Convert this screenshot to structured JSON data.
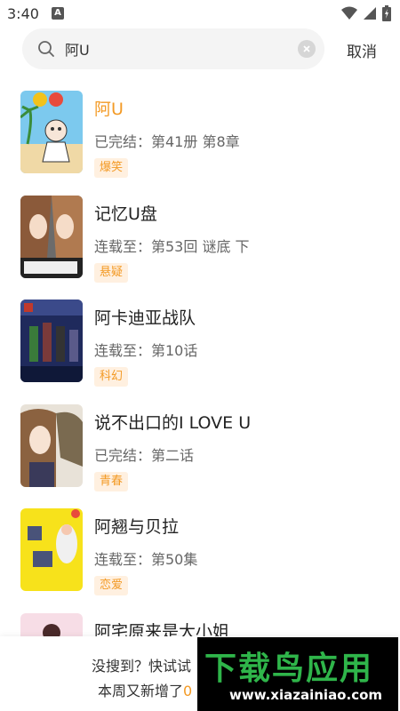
{
  "status_bar": {
    "time": "3:40",
    "notification_badge": "A"
  },
  "search": {
    "query": "阿U",
    "cancel_label": "取消"
  },
  "results": [
    {
      "title": "阿U",
      "status": "已完结：第41册 第8章",
      "tag": "爆笑",
      "highlight": true
    },
    {
      "title": "记忆U盘",
      "status": "连载至：第53回 谜底 下",
      "tag": "悬疑",
      "highlight": false
    },
    {
      "title": "阿卡迪亚战队",
      "status": "连载至：第10话",
      "tag": "科幻",
      "highlight": false
    },
    {
      "title": "说不出口的I LOVE U",
      "status": "已完结：第二话",
      "tag": "青春",
      "highlight": false
    },
    {
      "title": "阿翘与贝拉",
      "status": "连载至：第50集",
      "tag": "恋爱",
      "highlight": false
    },
    {
      "title": "阿宅原来是大小姐",
      "status": "",
      "tag": "",
      "highlight": false
    }
  ],
  "bottom_hint": {
    "line1": "没搜到？快试试",
    "line2_prefix": "本周又新增了",
    "line2_number": "0"
  },
  "watermark": {
    "title": "下载鸟应用",
    "url": "www.xiazainiao.com"
  },
  "colors": {
    "accent": "#f39a25",
    "tag_bg": "#fff0e0"
  }
}
